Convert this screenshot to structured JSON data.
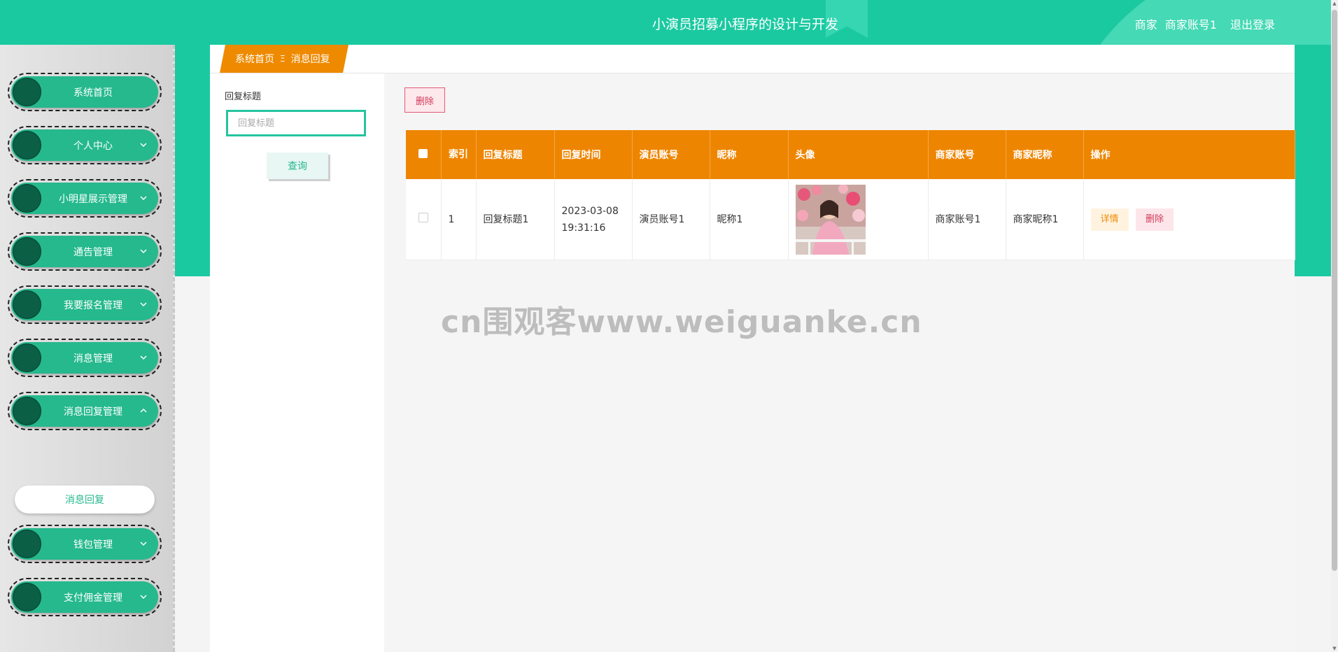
{
  "header": {
    "title": "小演员招募小程序的设计与开发",
    "user_role": "商家",
    "user_account": "商家账号1",
    "logout_label": "退出登录"
  },
  "sidebar": {
    "items": [
      {
        "label": "系统首页",
        "expandable": false
      },
      {
        "label": "个人中心",
        "expandable": true
      },
      {
        "label": "小明星展示管理",
        "expandable": true
      },
      {
        "label": "通告管理",
        "expandable": true
      },
      {
        "label": "我要报名管理",
        "expandable": true
      },
      {
        "label": "消息管理",
        "expandable": true
      },
      {
        "label": "消息回复管理",
        "expandable": true,
        "expanded": true
      },
      {
        "label": "钱包管理",
        "expandable": true
      },
      {
        "label": "支付佣金管理",
        "expandable": true
      }
    ],
    "active_sub_item": "消息回复"
  },
  "breadcrumb": {
    "home": "系统首页",
    "separator": "Ξ",
    "current": "消息回复"
  },
  "search": {
    "label": "回复标题",
    "placeholder": "回复标题",
    "value": "",
    "button_label": "查询"
  },
  "toolbar": {
    "delete_label": "删除"
  },
  "table": {
    "columns": [
      "",
      "索引",
      "回复标题",
      "回复时间",
      "演员账号",
      "昵称",
      "头像",
      "商家账号",
      "商家昵称",
      "操作"
    ],
    "rows": [
      {
        "index": "1",
        "title": "回复标题1",
        "time_date": "2023-03-08",
        "time_clock": "19:31:16",
        "actor_account": "演员账号1",
        "nickname": "昵称1",
        "merchant_account": "商家账号1",
        "merchant_nickname": "商家昵称1",
        "detail_label": "详情",
        "delete_label": "删除"
      }
    ]
  },
  "watermark": "cn围观客www.weiguanke.cn",
  "colors": {
    "primary": "#1bc9a1",
    "menu": "#25b98d",
    "menu_circle": "#0a5f45",
    "table_header": "#ee8500",
    "danger": "#d23a5a"
  }
}
